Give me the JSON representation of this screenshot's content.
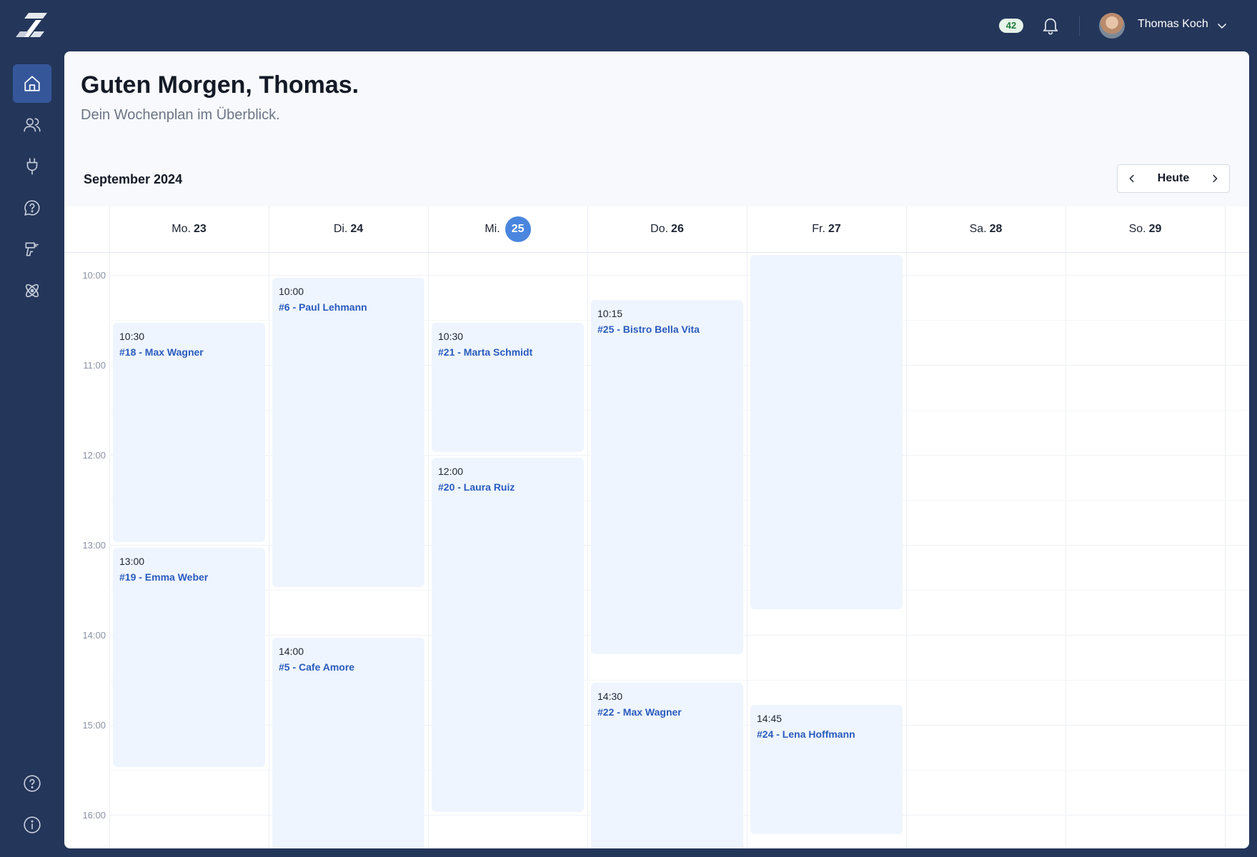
{
  "topbar": {
    "count_badge": "42",
    "user_name": "Thomas Koch"
  },
  "sidebar": {
    "items": [
      {
        "icon": "home-icon",
        "active": true
      },
      {
        "icon": "users-icon"
      },
      {
        "icon": "plug-icon"
      },
      {
        "icon": "chat-icon"
      },
      {
        "icon": "tools-icon"
      },
      {
        "icon": "atom-icon"
      }
    ],
    "bottom": [
      {
        "icon": "help-icon"
      },
      {
        "icon": "info-icon"
      }
    ]
  },
  "header": {
    "greeting": "Guten Morgen, Thomas.",
    "subtitle": "Dein Wochenplan im Überblick."
  },
  "calendar": {
    "month": "September 2024",
    "today_button": "Heute",
    "days": [
      {
        "weekday": "Mo.",
        "date": "23"
      },
      {
        "weekday": "Di.",
        "date": "24"
      },
      {
        "weekday": "Mi.",
        "date": "25",
        "today": true
      },
      {
        "weekday": "Do.",
        "date": "26"
      },
      {
        "weekday": "Fr.",
        "date": "27"
      },
      {
        "weekday": "Sa.",
        "date": "28"
      },
      {
        "weekday": "So.",
        "date": "29"
      }
    ],
    "hours": [
      "10:00",
      "11:00",
      "12:00",
      "13:00",
      "14:00",
      "15:00",
      "16:00"
    ],
    "events": [
      {
        "day": 0,
        "time": "10:30",
        "title": "#18 - Max Wagner",
        "start": "10:30",
        "end": "13:00"
      },
      {
        "day": 0,
        "time": "13:00",
        "title": "#19 - Emma Weber",
        "start": "13:00",
        "end": "15:30"
      },
      {
        "day": 1,
        "time": "10:00",
        "title": "#6 - Paul Lehmann",
        "start": "10:00",
        "end": "13:30"
      },
      {
        "day": 1,
        "time": "14:00",
        "title": "#5 - Cafe Amore",
        "start": "14:00",
        "end": "16:30"
      },
      {
        "day": 2,
        "time": "10:30",
        "title": "#21 - Marta Schmidt",
        "start": "10:30",
        "end": "12:00"
      },
      {
        "day": 2,
        "time": "12:00",
        "title": "#20 - Laura Ruiz",
        "start": "12:00",
        "end": "16:00"
      },
      {
        "day": 3,
        "time": "10:15",
        "title": "#25 - Bistro Bella Vita",
        "start": "10:15",
        "end": "14:15"
      },
      {
        "day": 3,
        "time": "14:30",
        "title": "#22 - Max Wagner",
        "start": "14:30",
        "end": "16:30"
      },
      {
        "day": 4,
        "time": "",
        "title": "",
        "start": "09:45",
        "end": "13:45"
      },
      {
        "day": 4,
        "time": "14:45",
        "title": "#24 - Lena Hoffmann",
        "start": "14:45",
        "end": "16:15"
      }
    ]
  }
}
